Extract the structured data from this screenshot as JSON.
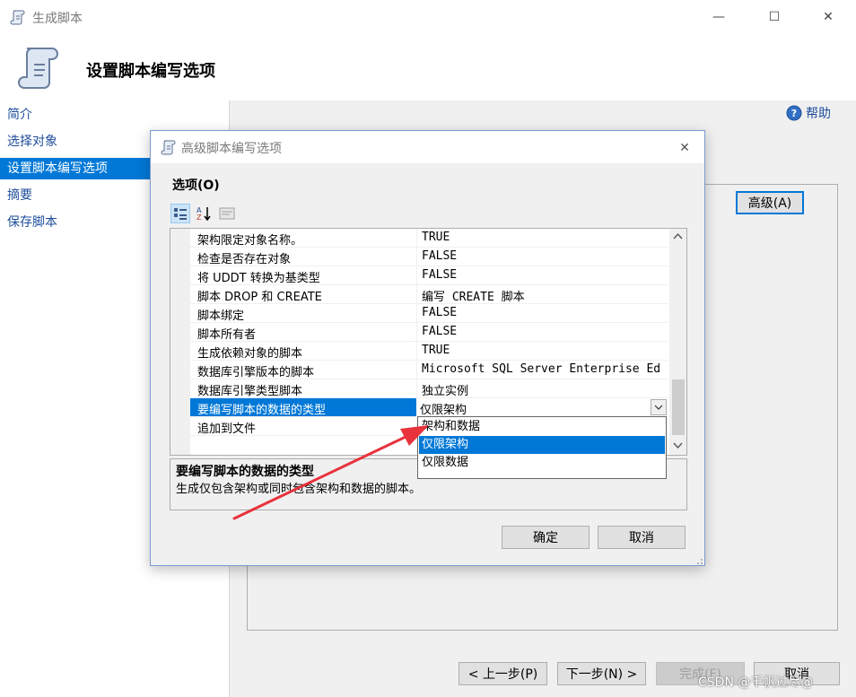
{
  "main": {
    "title": "生成脚本",
    "header_title": "设置脚本编写选项",
    "help_label": "帮助",
    "advanced_label": "高级(A)",
    "controls": {
      "minimize": "—",
      "maximize": "☐",
      "close": "✕"
    }
  },
  "sidebar": {
    "items": [
      {
        "label": "简介"
      },
      {
        "label": "选择对象"
      },
      {
        "label": "设置脚本编写选项",
        "active": true
      },
      {
        "label": "摘要"
      },
      {
        "label": "保存脚本"
      }
    ]
  },
  "footer": {
    "prev_label": "< 上一步(P)",
    "next_label": "下一步(N) >",
    "finish_label": "完成(F)",
    "cancel_label": "取消"
  },
  "dialog": {
    "title": "高级脚本编写选项",
    "close_glyph": "✕",
    "options_label": "选项(O)",
    "rows": [
      {
        "name": "架构限定对象名称。",
        "value": "TRUE"
      },
      {
        "name": "检查是否存在对象",
        "value": "FALSE"
      },
      {
        "name": "将 UDDT 转换为基类型",
        "value": "FALSE"
      },
      {
        "name": "脚本 DROP 和 CREATE",
        "value": "编写 CREATE 脚本"
      },
      {
        "name": "脚本绑定",
        "value": "FALSE"
      },
      {
        "name": "脚本所有者",
        "value": "FALSE"
      },
      {
        "name": "生成依赖对象的脚本",
        "value": "TRUE"
      },
      {
        "name": "数据库引擎版本的脚本",
        "value": "Microsoft SQL Server Enterprise Ed"
      },
      {
        "name": "数据库引擎类型脚本",
        "value": "独立实例"
      },
      {
        "name": "要编写脚本的数据的类型",
        "value": "仅限架构",
        "selected": true
      },
      {
        "name": "追加到文件",
        "value": ""
      }
    ],
    "dropdown_options": [
      "架构和数据",
      "仅限架构",
      "仅限数据"
    ],
    "dropdown_selected_index": 1,
    "description_title": "要编写脚本的数据的类型",
    "description_text": "生成仅包含架构或同时包含架构和数据的脚本。",
    "ok_label": "确定",
    "cancel_label": "取消"
  },
  "watermark": "CSDN @千帆过尽@",
  "colors": {
    "accent": "#0078d7",
    "link": "#1e4e9a",
    "annotation_arrow": "#e8323c"
  }
}
